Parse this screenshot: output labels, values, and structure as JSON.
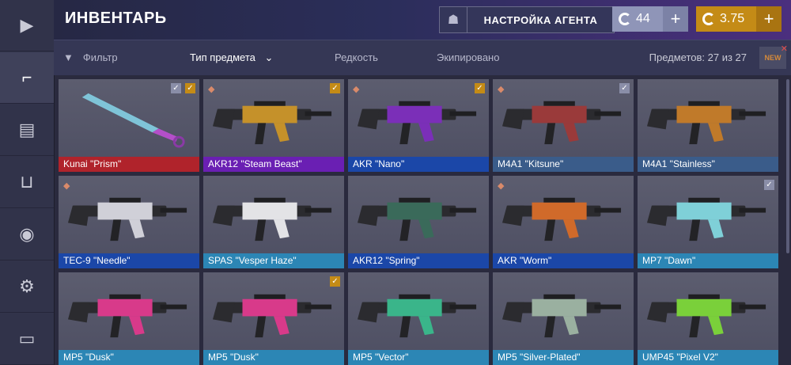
{
  "header": {
    "title": "ИНВЕНТАРЬ",
    "agent_label": "НАСТРОЙКА АГЕНТА",
    "silver_value": "44",
    "gold_value": "3.75",
    "plus": "+"
  },
  "filterbar": {
    "filter": "Фильтр",
    "type": "Тип предмета",
    "rarity": "Редкость",
    "equipped": "Экипировано",
    "count": "Предметов: 27 из 27",
    "new_badge": "NEW"
  },
  "colors": {
    "red": "#b0232b",
    "purple": "#6a1fb3",
    "blue": "#1b47a8",
    "steel": "#3a5c8a",
    "teal": "#2c86b5",
    "gold": "#c48b16",
    "silver": "#8f95b8"
  },
  "sidebar": {
    "items": [
      {
        "name": "play-icon",
        "glyph": "▶"
      },
      {
        "name": "pistol-icon",
        "glyph": "⌐"
      },
      {
        "name": "cases-icon",
        "glyph": "▤"
      },
      {
        "name": "cart-icon",
        "glyph": "⊔"
      },
      {
        "name": "agent-icon",
        "glyph": "◉"
      },
      {
        "name": "gear-icon",
        "glyph": "⚙"
      },
      {
        "name": "chat-icon",
        "glyph": "▭"
      }
    ]
  },
  "items": [
    {
      "name": "Kunai \"Prism\"",
      "rarity": "red",
      "checks": [
        "silver",
        "gold"
      ],
      "sticker": false
    },
    {
      "name": "AKR12 \"Steam Beast\"",
      "rarity": "purple",
      "checks": [
        "gold"
      ],
      "sticker": true
    },
    {
      "name": "AKR \"Nano\"",
      "rarity": "blue",
      "checks": [
        "gold"
      ],
      "sticker": true
    },
    {
      "name": "M4A1 \"Kitsune\"",
      "rarity": "steel",
      "checks": [
        "silver"
      ],
      "sticker": true
    },
    {
      "name": "M4A1 \"Stainless\"",
      "rarity": "steel",
      "checks": [],
      "sticker": false
    },
    {
      "name": "TEC-9 \"Needle\"",
      "rarity": "blue",
      "checks": [],
      "sticker": true
    },
    {
      "name": "SPAS \"Vesper Haze\"",
      "rarity": "teal",
      "checks": [],
      "sticker": false
    },
    {
      "name": "AKR12 \"Spring\"",
      "rarity": "blue",
      "checks": [],
      "sticker": false
    },
    {
      "name": "AKR \"Worm\"",
      "rarity": "blue",
      "checks": [],
      "sticker": true
    },
    {
      "name": "MP7 \"Dawn\"",
      "rarity": "teal",
      "checks": [
        "silver"
      ],
      "sticker": false
    },
    {
      "name": "MP5 \"Dusk\"",
      "rarity": "teal",
      "checks": [],
      "sticker": false
    },
    {
      "name": "MP5 \"Dusk\"",
      "rarity": "teal",
      "checks": [
        "gold"
      ],
      "sticker": false
    },
    {
      "name": "MP5 \"Vector\"",
      "rarity": "teal",
      "checks": [],
      "sticker": false
    },
    {
      "name": "MP5 \"Silver-Plated\"",
      "rarity": "teal",
      "checks": [],
      "sticker": false
    },
    {
      "name": "UMP45 \"Pixel V2\"",
      "rarity": "teal",
      "checks": [],
      "sticker": false
    }
  ]
}
